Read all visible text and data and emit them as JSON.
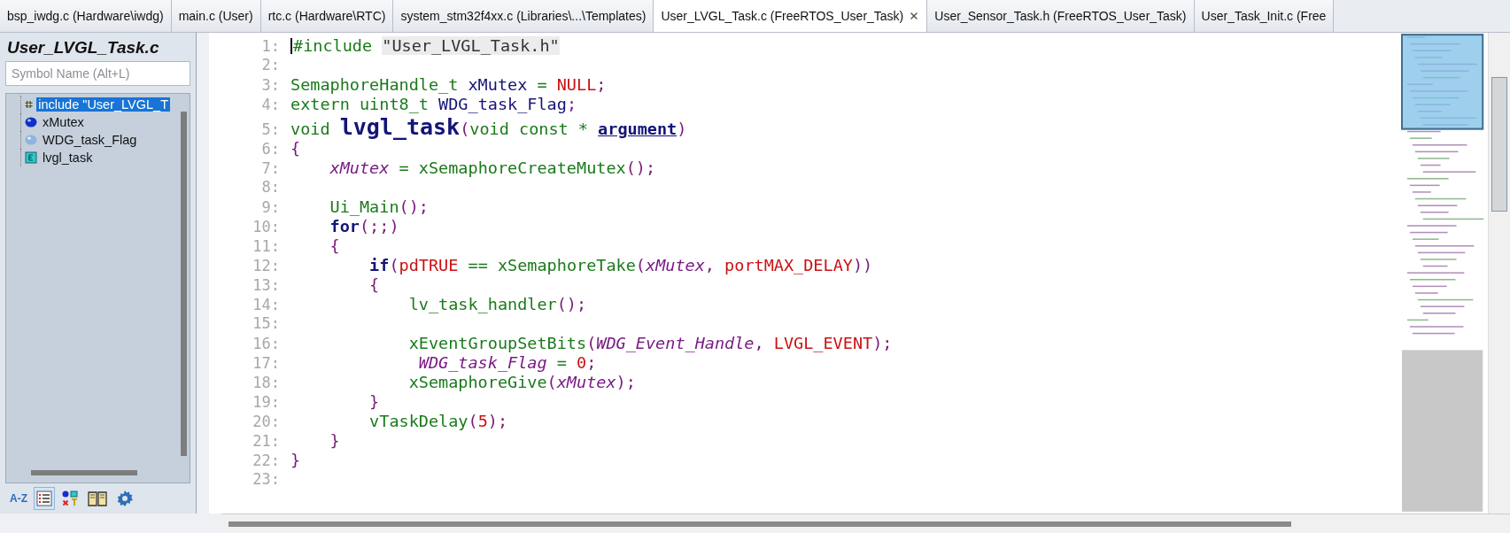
{
  "tabs": [
    {
      "label": "bsp_iwdg.c (Hardware\\iwdg)",
      "selected": false
    },
    {
      "label": "main.c (User)",
      "selected": false
    },
    {
      "label": "rtc.c (Hardware\\RTC)",
      "selected": false
    },
    {
      "label": "system_stm32f4xx.c (Libraries\\...\\Templates)",
      "selected": false
    },
    {
      "label": "User_LVGL_Task.c (FreeRTOS_User_Task)",
      "selected": true
    },
    {
      "label": "User_Sensor_Task.h (FreeRTOS_User_Task)",
      "selected": false
    },
    {
      "label": "User_Task_Init.c (Free",
      "selected": false
    }
  ],
  "symbol_panel": {
    "title": "User_LVGL_Task.c",
    "search": {
      "placeholder": "Symbol Name (Alt+L)"
    },
    "items": [
      {
        "label": "include \"User_LVGL_T",
        "kind": "include",
        "selected": true
      },
      {
        "label": "xMutex",
        "kind": "variable",
        "selected": false
      },
      {
        "label": "WDG_task_Flag",
        "kind": "extern",
        "selected": false
      },
      {
        "label": "lvgl_task",
        "kind": "function",
        "selected": false
      }
    ],
    "toolbar": [
      {
        "kind": "sort",
        "label": "A-Z",
        "selected": false
      },
      {
        "kind": "list",
        "selected": true
      },
      {
        "kind": "symbols",
        "selected": false
      },
      {
        "kind": "book",
        "selected": false
      },
      {
        "kind": "settings",
        "selected": false
      }
    ]
  },
  "editor": {
    "lines": [
      {
        "number": "1:",
        "tokens": [
          {
            "text": "#include ",
            "kind": "pre"
          },
          {
            "text": "\"User_LVGL_Task.h\"",
            "kind": "string"
          }
        ]
      },
      {
        "number": "2:"
      },
      {
        "number": "3:",
        "tokens": [
          {
            "text": "SemaphoreHandle_t ",
            "kind": "type"
          },
          {
            "text": "xMutex ",
            "kind": "name"
          },
          {
            "text": "= ",
            "kind": "op"
          },
          {
            "text": "NULL",
            "kind": "macro"
          },
          {
            "text": ";",
            "kind": "punct"
          }
        ]
      },
      {
        "number": "4:",
        "tokens": [
          {
            "text": "extern uint8_t ",
            "kind": "type"
          },
          {
            "text": "WDG_task_Flag",
            "kind": "name"
          },
          {
            "text": ";",
            "kind": "punct"
          }
        ]
      },
      {
        "number": "5:",
        "tokens": [
          {
            "text": "void ",
            "kind": "type"
          },
          {
            "text": "lvgl_task",
            "kind": "decl"
          },
          {
            "text": "(",
            "kind": "punct"
          },
          {
            "text": "void const * ",
            "kind": "type"
          },
          {
            "text": "argument",
            "kind": "param"
          },
          {
            "text": ")",
            "kind": "punct"
          }
        ]
      },
      {
        "number": "6:",
        "tokens": [
          {
            "text": "{",
            "kind": "punct"
          }
        ]
      },
      {
        "number": "7:",
        "tokens": [
          {
            "text": "    xMutex",
            "kind": "global"
          },
          {
            "text": " = xSemaphoreCreateMutex",
            "kind": "func"
          },
          {
            "text": "();",
            "kind": "punct"
          }
        ]
      },
      {
        "number": "8:"
      },
      {
        "number": "9:",
        "tokens": [
          {
            "text": "    Ui_Main",
            "kind": "func"
          },
          {
            "text": "();",
            "kind": "punct"
          }
        ]
      },
      {
        "number": "10:",
        "tokens": [
          {
            "text": "    for",
            "kind": "keyword"
          },
          {
            "text": "(;;)",
            "kind": "punct"
          }
        ]
      },
      {
        "number": "11:",
        "tokens": [
          {
            "text": "    {",
            "kind": "punct"
          }
        ]
      },
      {
        "number": "12:",
        "tokens": [
          {
            "text": "        if",
            "kind": "keyword"
          },
          {
            "text": "(",
            "kind": "punct"
          },
          {
            "text": "pdTRUE ",
            "kind": "macro"
          },
          {
            "text": "== xSemaphoreTake",
            "kind": "func"
          },
          {
            "text": "(",
            "kind": "punct"
          },
          {
            "text": "xMutex",
            "kind": "global"
          },
          {
            "text": ", ",
            "kind": "punct"
          },
          {
            "text": "portMAX_DELAY",
            "kind": "macro"
          },
          {
            "text": "))",
            "kind": "punct"
          }
        ]
      },
      {
        "number": "13:",
        "tokens": [
          {
            "text": "        {",
            "kind": "punct"
          }
        ]
      },
      {
        "number": "14:",
        "tokens": [
          {
            "text": "            lv_task_handler",
            "kind": "func"
          },
          {
            "text": "();",
            "kind": "punct"
          }
        ]
      },
      {
        "number": "15:"
      },
      {
        "number": "16:",
        "tokens": [
          {
            "text": "            xEventGroupSetBits",
            "kind": "func"
          },
          {
            "text": "(",
            "kind": "punct"
          },
          {
            "text": "WDG_Event_Handle",
            "kind": "global"
          },
          {
            "text": ", ",
            "kind": "punct"
          },
          {
            "text": "LVGL_EVENT",
            "kind": "macro"
          },
          {
            "text": ");",
            "kind": "punct"
          }
        ]
      },
      {
        "number": "17:",
        "tokens": [
          {
            "text": "             WDG_task_Flag",
            "kind": "global"
          },
          {
            "text": " = ",
            "kind": "func"
          },
          {
            "text": "0",
            "kind": "macro"
          },
          {
            "text": ";",
            "kind": "punct"
          }
        ]
      },
      {
        "number": "18:",
        "tokens": [
          {
            "text": "            xSemaphoreGive",
            "kind": "func"
          },
          {
            "text": "(",
            "kind": "punct"
          },
          {
            "text": "xMutex",
            "kind": "global"
          },
          {
            "text": ");",
            "kind": "punct"
          }
        ]
      },
      {
        "number": "19:",
        "tokens": [
          {
            "text": "        }",
            "kind": "punct"
          }
        ]
      },
      {
        "number": "20:",
        "tokens": [
          {
            "text": "        vTaskDelay",
            "kind": "func"
          },
          {
            "text": "(",
            "kind": "punct"
          },
          {
            "text": "5",
            "kind": "macro"
          },
          {
            "text": ");",
            "kind": "punct"
          }
        ]
      },
      {
        "number": "21:",
        "tokens": [
          {
            "text": "    }",
            "kind": "punct"
          }
        ]
      },
      {
        "number": "22:",
        "tokens": [
          {
            "text": "}",
            "kind": "punct"
          }
        ]
      },
      {
        "number": "23:"
      }
    ]
  }
}
